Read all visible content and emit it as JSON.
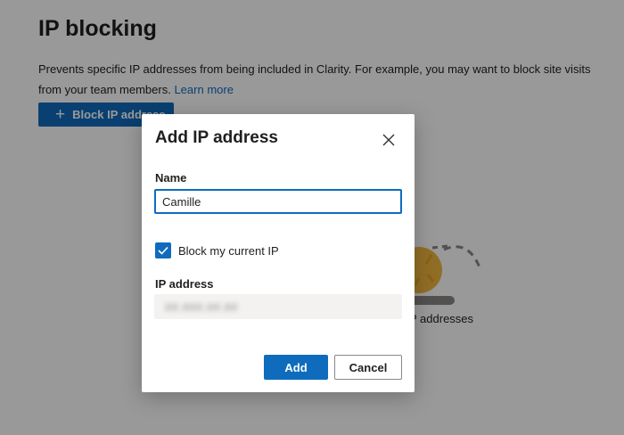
{
  "page": {
    "title": "IP blocking",
    "description": "Prevents specific IP addresses from being included in Clarity. For example, you may want to block site visits from your team members.",
    "learn_more": "Learn more",
    "block_button_label": "Block IP address",
    "empty_state_text": "P addresses"
  },
  "dialog": {
    "title": "Add IP address",
    "name_label": "Name",
    "name_value": "Camille",
    "checkbox_label": "Block my current IP",
    "checkbox_checked": true,
    "ip_label": "IP address",
    "ip_value": "##.###.##.##",
    "add_label": "Add",
    "cancel_label": "Cancel"
  },
  "colors": {
    "accent": "#0f6cbd",
    "overlay": "rgba(0,0,0,0.4)",
    "ip_field_bg": "#f3f2f1"
  },
  "icons": {
    "close": "close-icon",
    "plus": "plus-icon",
    "checkmark": "checkmark-icon"
  }
}
